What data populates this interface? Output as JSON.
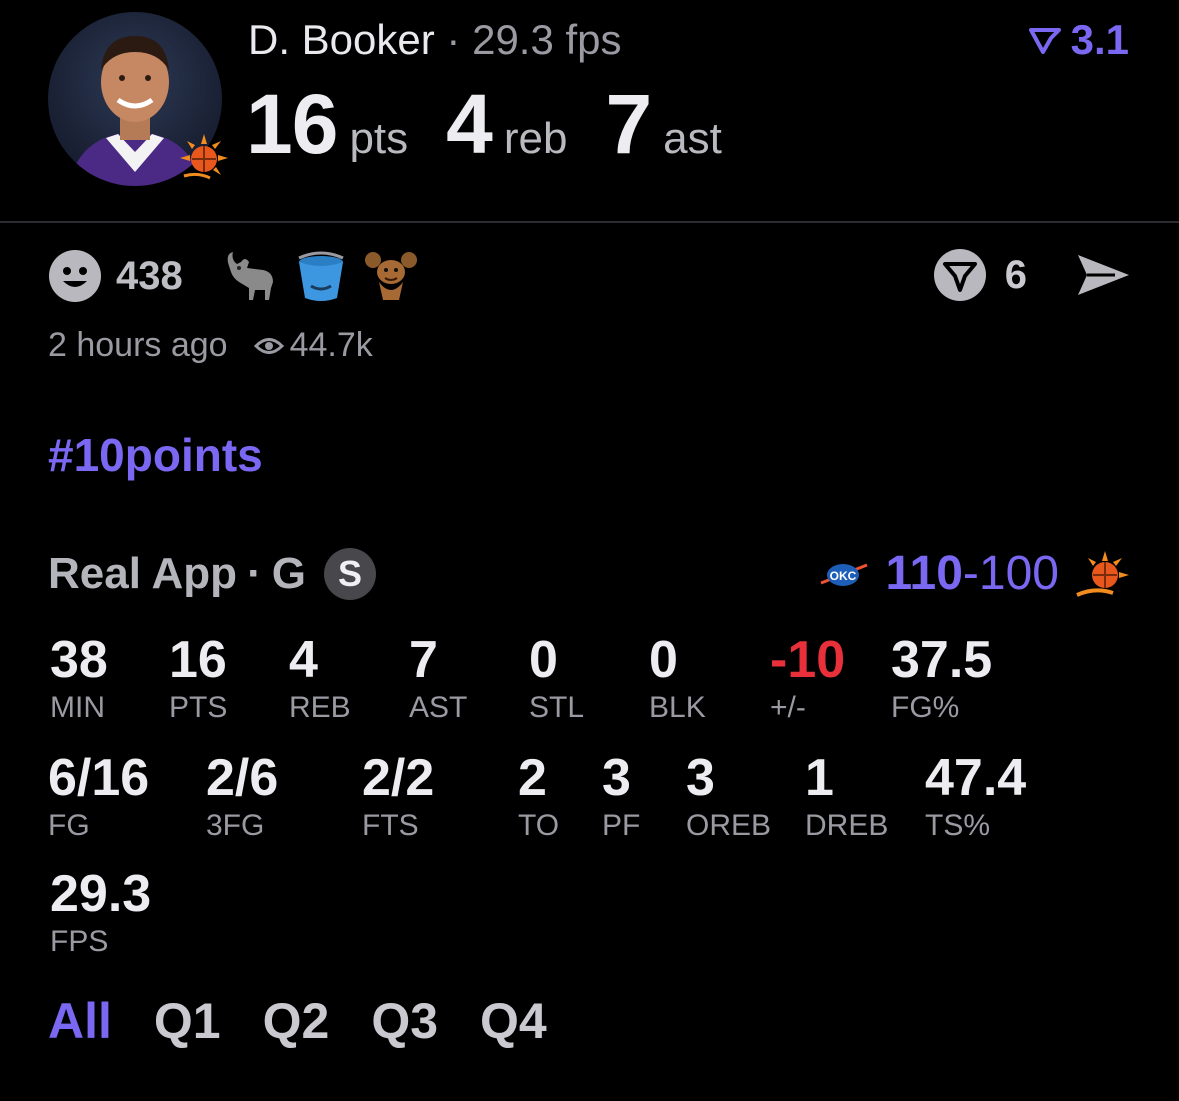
{
  "header": {
    "player_name": "D. Booker",
    "separator": "·",
    "fps_text": "29.3 fps",
    "rank_value": "3.1",
    "big_stats": [
      {
        "value": "16",
        "unit": "pts"
      },
      {
        "value": "4",
        "unit": "reb"
      },
      {
        "value": "7",
        "unit": "ast"
      }
    ]
  },
  "reactions": {
    "count": "438",
    "items": [
      "goat",
      "bucket",
      "mouse"
    ],
    "share_count": "6"
  },
  "meta": {
    "time_ago": "2 hours ago",
    "views": "44.7k"
  },
  "hashtag": "#10points",
  "source": {
    "name": "Real App",
    "separator": "·",
    "position": "G",
    "badge": "S"
  },
  "game": {
    "away_team": "OKC",
    "score_win": "110",
    "score_dash": "-",
    "score_lose": "100",
    "home_team": "PHX"
  },
  "stats_row1": [
    {
      "value": "38",
      "label": "MIN"
    },
    {
      "value": "16",
      "label": "PTS"
    },
    {
      "value": "4",
      "label": "REB"
    },
    {
      "value": "7",
      "label": "AST"
    },
    {
      "value": "0",
      "label": "STL"
    },
    {
      "value": "0",
      "label": "BLK"
    },
    {
      "value": "-10",
      "label": "+/-"
    },
    {
      "value": "37.5",
      "label": "FG%"
    }
  ],
  "stats_row2": [
    {
      "value": "6/16",
      "label": "FG"
    },
    {
      "value": "2/6",
      "label": "3FG"
    },
    {
      "value": "2/2",
      "label": "FTS"
    },
    {
      "value": "2",
      "label": "TO"
    },
    {
      "value": "3",
      "label": "PF"
    },
    {
      "value": "3",
      "label": "OREB"
    },
    {
      "value": "1",
      "label": "DREB"
    },
    {
      "value": "47.4",
      "label": "TS%"
    }
  ],
  "stats_row3": [
    {
      "value": "29.3",
      "label": "FPS"
    }
  ],
  "tabs": [
    "All",
    "Q1",
    "Q2",
    "Q3",
    "Q4"
  ],
  "colors": {
    "accent": "#7b68f2",
    "negative": "#e8303a",
    "background": "#000000"
  }
}
